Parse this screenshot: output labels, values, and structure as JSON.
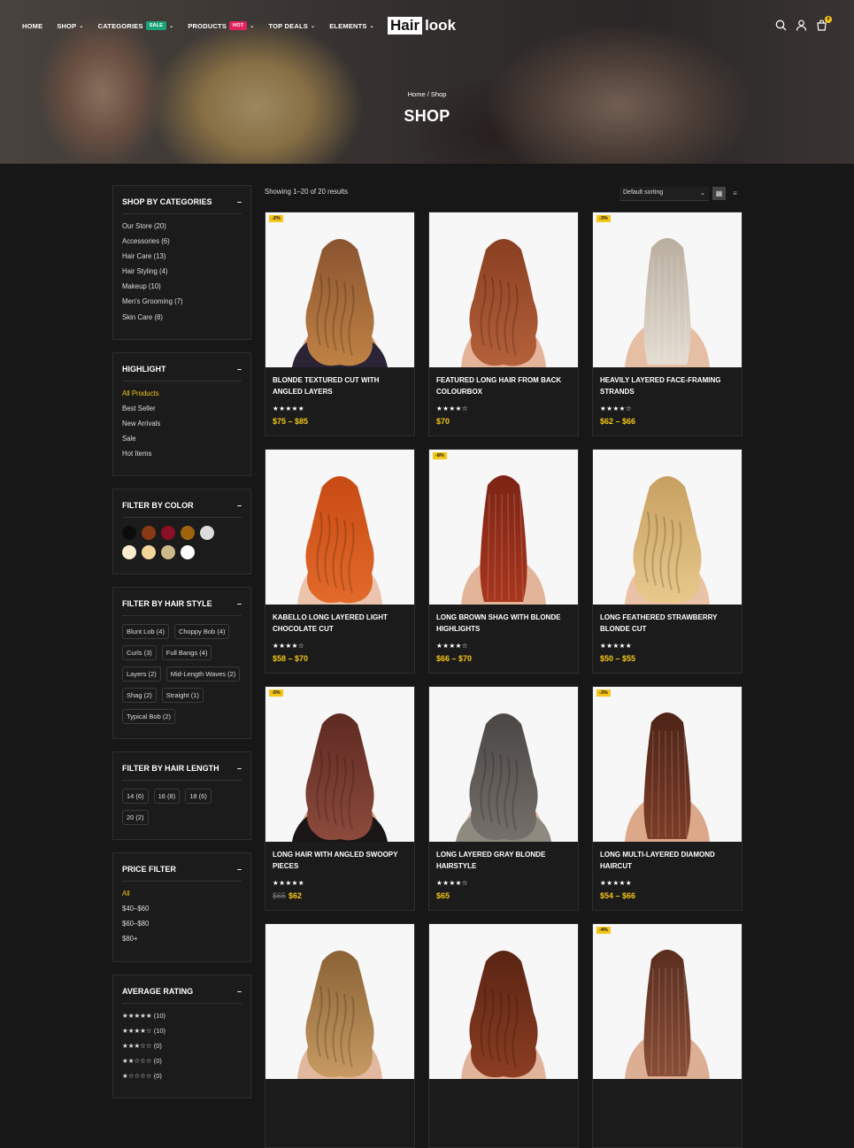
{
  "nav": {
    "items": [
      {
        "label": "HOME",
        "caret": false,
        "badge": null
      },
      {
        "label": "SHOP",
        "caret": true,
        "badge": null
      },
      {
        "label": "CATEGORIES",
        "caret": true,
        "badge": "SALE"
      },
      {
        "label": "PRODUCTS",
        "caret": true,
        "badge": "HOT"
      },
      {
        "label": "TOP DEALS",
        "caret": true,
        "badge": null
      },
      {
        "label": "ELEMENTS",
        "caret": true,
        "badge": null
      }
    ],
    "logo_box": "Hair",
    "logo_text": "look",
    "cart_count": "0",
    "icons": [
      "search-icon",
      "user-icon",
      "cart-icon"
    ]
  },
  "hero": {
    "breadcrumb": "Home / Shop",
    "title": "SHOP"
  },
  "sidebar": {
    "categories": {
      "title": "SHOP BY CATEGORIES",
      "toggle": "–",
      "items": [
        "Our Store (20)",
        "Accessories (6)",
        "Hair Care (13)",
        "Hair Styling (4)",
        "Makeup (10)",
        "Men's Grooming (7)",
        "Skin Care (8)"
      ]
    },
    "highlight": {
      "title": "HIGHLIGHT",
      "toggle": "–",
      "items": [
        "All Products",
        "Best Seller",
        "New Arrivals",
        "Sale",
        "Hot Items"
      ],
      "active": "All Products"
    },
    "color": {
      "title": "FILTER BY COLOR",
      "toggle": "–",
      "swatches": [
        "#0c0c0c",
        "#8a3a12",
        "#8b0f25",
        "#a0620f",
        "#dcdcdc",
        "#f8ecce",
        "#f2d59a",
        "#cbb98a",
        "#ffffff"
      ]
    },
    "hairstyle": {
      "title": "FILTER BY HAIR STYLE",
      "toggle": "–",
      "tags": [
        "Blunt Lob (4)",
        "Choppy Bob (4)",
        "Curls (3)",
        "Full Bangs (4)",
        "Layers (2)",
        "Mid-Length Waves (2)",
        "Shag (2)",
        "Straight (1)",
        "Typical Bob (2)"
      ]
    },
    "length": {
      "title": "FILTER BY HAIR LENGTH",
      "toggle": "–",
      "tags": [
        "14 (6)",
        "16 (8)",
        "18 (6)",
        "20 (2)"
      ]
    },
    "price": {
      "title": "PRICE FILTER",
      "toggle": "–",
      "items": [
        "All",
        "$40–$60",
        "$60–$80",
        "$80+"
      ],
      "active": "All"
    },
    "rating": {
      "title": "AVERAGE RATING",
      "toggle": "–",
      "rows": [
        {
          "stars": "★★★★★",
          "count": "(10)"
        },
        {
          "stars": "★★★★☆",
          "count": "(10)"
        },
        {
          "stars": "★★★☆☆",
          "count": "(0)"
        },
        {
          "stars": "★★☆☆☆",
          "count": "(0)"
        },
        {
          "stars": "★☆☆☆☆",
          "count": "(0)"
        }
      ]
    }
  },
  "toolbar": {
    "results": "Showing 1–20 of 20 results",
    "sort": "Default sorting"
  },
  "products": [
    {
      "name": "BLONDE TEXTURED CUT WITH ANGLED LAYERS",
      "discount": "-2%",
      "stars": "★★★★★",
      "old": "",
      "price": "$75 – $85",
      "hair": "#8a5430",
      "hair2": "#c08244",
      "skin": "#d7a07f",
      "top": "#2a2436",
      "curly": true
    },
    {
      "name": "FEATURED LONG HAIR FROM BACK COLOURBOX",
      "discount": "",
      "stars": "★★★★☆",
      "old": "",
      "price": "$70",
      "hair": "#8a3f22",
      "hair2": "#b4613a",
      "skin": "#e4b49a",
      "top": "",
      "curly": true
    },
    {
      "name": "HEAVILY LAYERED FACE-FRAMING STRANDS",
      "discount": "-3%",
      "stars": "★★★★☆",
      "old": "",
      "price": "$62 – $66",
      "hair": "#b9ad9f",
      "hair2": "#e4ddd2",
      "skin": "#e6bea4",
      "top": "",
      "curly": false
    },
    {
      "name": "KABELLO LONG LAYERED LIGHT CHOCOLATE CUT",
      "discount": "",
      "stars": "★★★★☆",
      "old": "",
      "price": "$58 – $70",
      "hair": "#c84a14",
      "hair2": "#e26a2a",
      "skin": "#ecc4ae",
      "top": "",
      "curly": true
    },
    {
      "name": "LONG BROWN SHAG WITH BLONDE HIGHLIGHTS",
      "discount": "-8%",
      "stars": "★★★★☆",
      "old": "",
      "price": "$66 – $70",
      "hair": "#7c2414",
      "hair2": "#a8361e",
      "skin": "#e2b49a",
      "top": "",
      "curly": false
    },
    {
      "name": "LONG FEATHERED STRAWBERRY BLONDE CUT",
      "discount": "",
      "stars": "★★★★★",
      "old": "",
      "price": "$50 – $55",
      "hair": "#c7a061",
      "hair2": "#e8c98c",
      "skin": "#eac2a8",
      "top": "",
      "curly": true
    },
    {
      "name": "LONG HAIR WITH ANGLED SWOOPY PIECES",
      "discount": "-5%",
      "stars": "★★★★★",
      "old": "$65",
      "price": "$62",
      "hair": "#5e2a22",
      "hair2": "#8c4a3c",
      "skin": "#d9a890",
      "top": "#1a1616",
      "curly": true
    },
    {
      "name": "LONG LAYERED GRAY BLONDE HAIRSTYLE",
      "discount": "",
      "stars": "★★★★☆",
      "old": "",
      "price": "$65",
      "hair": "#4a4644",
      "hair2": "#75706b",
      "skin": "#e0c0aa",
      "top": "#8e8a80",
      "curly": true
    },
    {
      "name": "LONG MULTI-LAYERED DIAMOND HAIRCUT",
      "discount": "-3%",
      "stars": "★★★★★",
      "old": "",
      "price": "$54 – $66",
      "hair": "#4e2418",
      "hair2": "#7c3c26",
      "skin": "#dca88a",
      "top": "",
      "curly": false
    },
    {
      "name": "",
      "discount": "",
      "stars": "",
      "old": "",
      "price": "",
      "hair": "#8a6236",
      "hair2": "#c79b62",
      "skin": "#e2b89e",
      "top": "",
      "curly": true
    },
    {
      "name": "",
      "discount": "",
      "stars": "",
      "old": "",
      "price": "",
      "hair": "#5a2414",
      "hair2": "#8c3e22",
      "skin": "#e0b49a",
      "top": "",
      "curly": true
    },
    {
      "name": "",
      "discount": "-4%",
      "stars": "",
      "old": "",
      "price": "",
      "hair": "#5a2e20",
      "hair2": "#8a4e36",
      "skin": "#dcae94",
      "top": "",
      "curly": false
    }
  ]
}
